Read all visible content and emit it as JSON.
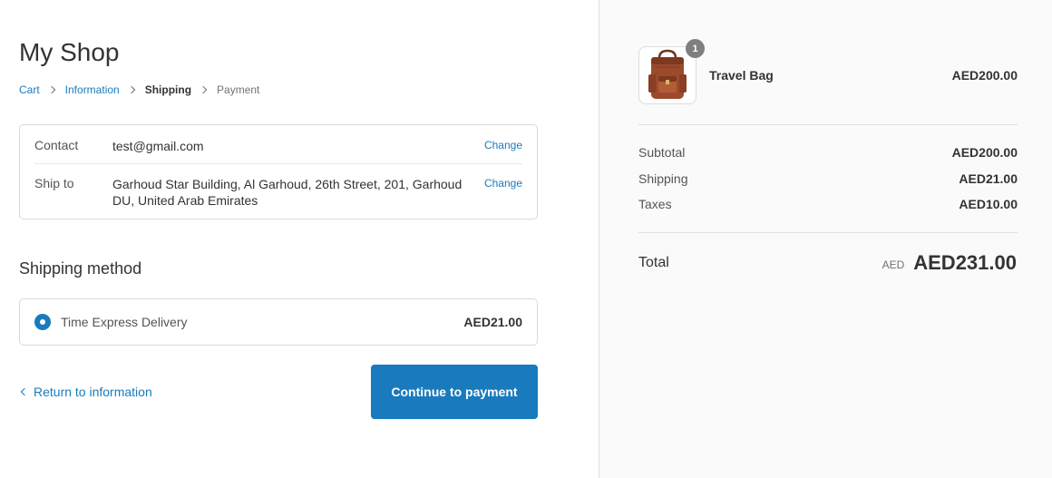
{
  "shop": {
    "title": "My Shop"
  },
  "breadcrumb": {
    "items": [
      {
        "label": "Cart",
        "state": "link"
      },
      {
        "label": "Information",
        "state": "link"
      },
      {
        "label": "Shipping",
        "state": "current"
      },
      {
        "label": "Payment",
        "state": "future"
      }
    ]
  },
  "review": {
    "contact": {
      "label": "Contact",
      "value": "test@gmail.com",
      "change_label": "Change"
    },
    "ship_to": {
      "label": "Ship to",
      "value": "Garhoud Star Building, Al Garhoud, 26th Street, 201, Garhoud DU, United Arab Emirates",
      "change_label": "Change"
    }
  },
  "shipping_method": {
    "title": "Shipping method",
    "selected": true,
    "name": "Time Express Delivery",
    "price": "AED21.00"
  },
  "actions": {
    "return_label": "Return to information",
    "continue_label": "Continue to payment"
  },
  "order_summary": {
    "product": {
      "name": "Travel Bag",
      "price": "AED200.00",
      "quantity": "1",
      "image_icon": "travel-bag-image"
    },
    "subtotal": {
      "label": "Subtotal",
      "value": "AED200.00"
    },
    "shipping": {
      "label": "Shipping",
      "value": "AED21.00"
    },
    "taxes": {
      "label": "Taxes",
      "value": "AED10.00"
    },
    "total": {
      "label": "Total",
      "currency": "AED",
      "value": "AED231.00"
    }
  },
  "colors": {
    "accent": "#197bbd",
    "sidebar_bg": "#fafafa",
    "badge": "#7f7f7f"
  }
}
